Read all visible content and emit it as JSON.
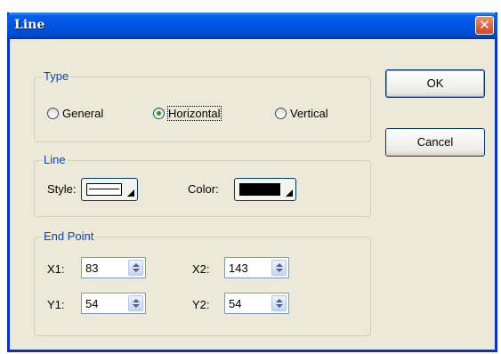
{
  "window": {
    "title": "Line",
    "close_glyph": "✕"
  },
  "type_group": {
    "legend": "Type",
    "options": [
      {
        "label": "General",
        "checked": false
      },
      {
        "label": "Horizontal",
        "checked": true
      },
      {
        "label": "Vertical",
        "checked": false
      }
    ]
  },
  "line_group": {
    "legend": "Line",
    "style_label": "Style:",
    "color_label": "Color:",
    "color_value": "#000000"
  },
  "end_point_group": {
    "legend": "End Point",
    "x1_label": "X1:",
    "x1_value": "83",
    "x2_label": "X2:",
    "x2_value": "143",
    "y1_label": "Y1:",
    "y1_value": "54",
    "y2_label": "Y2:",
    "y2_value": "54"
  },
  "buttons": {
    "ok": "OK",
    "cancel": "Cancel"
  }
}
